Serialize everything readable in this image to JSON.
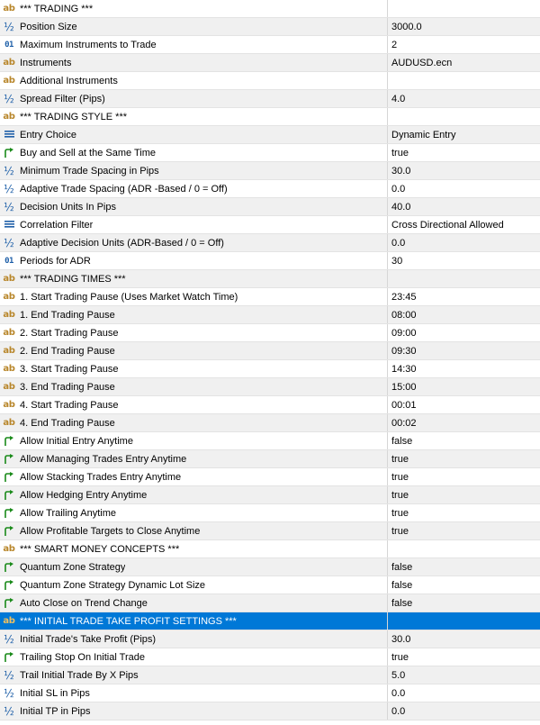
{
  "colors": {
    "selection": "#0078d7",
    "row_alt": "#f0f0f0",
    "icon_string": "#b8862a",
    "icon_bool": "#1a8a1a",
    "icon_number": "#1e5fa8"
  },
  "rows": [
    {
      "name": "*** TRADING ***",
      "value": "",
      "type": "string",
      "icon": "ab-string-icon"
    },
    {
      "name": "Position Size",
      "value": "3000.0",
      "type": "double",
      "icon": "fraction-icon"
    },
    {
      "name": "Maximum Instruments to Trade",
      "value": "2",
      "type": "integer",
      "icon": "integer-icon"
    },
    {
      "name": "Instruments",
      "value": "AUDUSD.ecn",
      "type": "string",
      "icon": "ab-string-icon"
    },
    {
      "name": "Additional Instruments",
      "value": "",
      "type": "string",
      "icon": "ab-string-icon"
    },
    {
      "name": "Spread Filter (Pips)",
      "value": "4.0",
      "type": "double",
      "icon": "fraction-icon"
    },
    {
      "name": "*** TRADING STYLE ***",
      "value": "",
      "type": "string",
      "icon": "ab-string-icon"
    },
    {
      "name": "Entry Choice",
      "value": "Dynamic Entry",
      "type": "enum",
      "icon": "enum-list-icon"
    },
    {
      "name": "Buy and Sell at the Same Time",
      "value": "true",
      "type": "bool",
      "icon": "bool-arrow-icon"
    },
    {
      "name": "Minimum Trade Spacing in Pips",
      "value": "30.0",
      "type": "double",
      "icon": "fraction-icon"
    },
    {
      "name": "Adaptive Trade Spacing (ADR -Based / 0 = Off)",
      "value": "0.0",
      "type": "double",
      "icon": "fraction-icon"
    },
    {
      "name": "Decision Units In Pips",
      "value": "40.0",
      "type": "double",
      "icon": "fraction-icon"
    },
    {
      "name": "Correlation Filter",
      "value": "Cross Directional Allowed",
      "type": "enum",
      "icon": "enum-list-icon"
    },
    {
      "name": "Adaptive Decision Units (ADR-Based / 0 = Off)",
      "value": "0.0",
      "type": "double",
      "icon": "fraction-icon"
    },
    {
      "name": "Periods for ADR",
      "value": "30",
      "type": "integer",
      "icon": "integer-icon"
    },
    {
      "name": "*** TRADING TIMES ***",
      "value": "",
      "type": "string",
      "icon": "ab-string-icon"
    },
    {
      "name": "1. Start Trading Pause (Uses Market Watch Time)",
      "value": "23:45",
      "type": "string",
      "icon": "ab-string-icon"
    },
    {
      "name": "1. End Trading Pause",
      "value": "08:00",
      "type": "string",
      "icon": "ab-string-icon"
    },
    {
      "name": "2. Start Trading Pause",
      "value": "09:00",
      "type": "string",
      "icon": "ab-string-icon"
    },
    {
      "name": "2. End Trading Pause",
      "value": "09:30",
      "type": "string",
      "icon": "ab-string-icon"
    },
    {
      "name": "3. Start Trading Pause",
      "value": "14:30",
      "type": "string",
      "icon": "ab-string-icon"
    },
    {
      "name": "3. End Trading Pause",
      "value": "15:00",
      "type": "string",
      "icon": "ab-string-icon"
    },
    {
      "name": "4. Start Trading Pause",
      "value": "00:01",
      "type": "string",
      "icon": "ab-string-icon"
    },
    {
      "name": "4. End Trading Pause",
      "value": "00:02",
      "type": "string",
      "icon": "ab-string-icon"
    },
    {
      "name": "Allow Initial Entry Anytime",
      "value": "false",
      "type": "bool",
      "icon": "bool-arrow-icon"
    },
    {
      "name": "Allow Managing Trades Entry Anytime",
      "value": "true",
      "type": "bool",
      "icon": "bool-arrow-icon"
    },
    {
      "name": "Allow Stacking Trades Entry Anytime",
      "value": "true",
      "type": "bool",
      "icon": "bool-arrow-icon"
    },
    {
      "name": "Allow Hedging Entry Anytime",
      "value": "true",
      "type": "bool",
      "icon": "bool-arrow-icon"
    },
    {
      "name": "Allow Trailing Anytime",
      "value": "true",
      "type": "bool",
      "icon": "bool-arrow-icon"
    },
    {
      "name": "Allow Profitable Targets to Close Anytime",
      "value": "true",
      "type": "bool",
      "icon": "bool-arrow-icon"
    },
    {
      "name": "*** SMART MONEY CONCEPTS ***",
      "value": "",
      "type": "string",
      "icon": "ab-string-icon"
    },
    {
      "name": "Quantum Zone Strategy",
      "value": "false",
      "type": "bool",
      "icon": "bool-arrow-icon"
    },
    {
      "name": "Quantum Zone Strategy Dynamic Lot Size",
      "value": "false",
      "type": "bool",
      "icon": "bool-arrow-icon"
    },
    {
      "name": "Auto Close on Trend Change",
      "value": "false",
      "type": "bool",
      "icon": "bool-arrow-icon"
    },
    {
      "name": "*** INITIAL TRADE TAKE PROFIT SETTINGS ***",
      "value": "",
      "type": "string",
      "icon": "ab-string-icon",
      "selected": true
    },
    {
      "name": "Initial Trade's Take Profit (Pips)",
      "value": "30.0",
      "type": "double",
      "icon": "fraction-icon"
    },
    {
      "name": "Trailing Stop On Initial Trade",
      "value": "true",
      "type": "bool",
      "icon": "bool-arrow-icon"
    },
    {
      "name": "Trail Initial Trade By X Pips",
      "value": "5.0",
      "type": "double",
      "icon": "fraction-icon"
    },
    {
      "name": "Initial SL in Pips",
      "value": "0.0",
      "type": "double",
      "icon": "fraction-icon"
    },
    {
      "name": "Initial TP in Pips",
      "value": "0.0",
      "type": "double",
      "icon": "fraction-icon"
    }
  ]
}
